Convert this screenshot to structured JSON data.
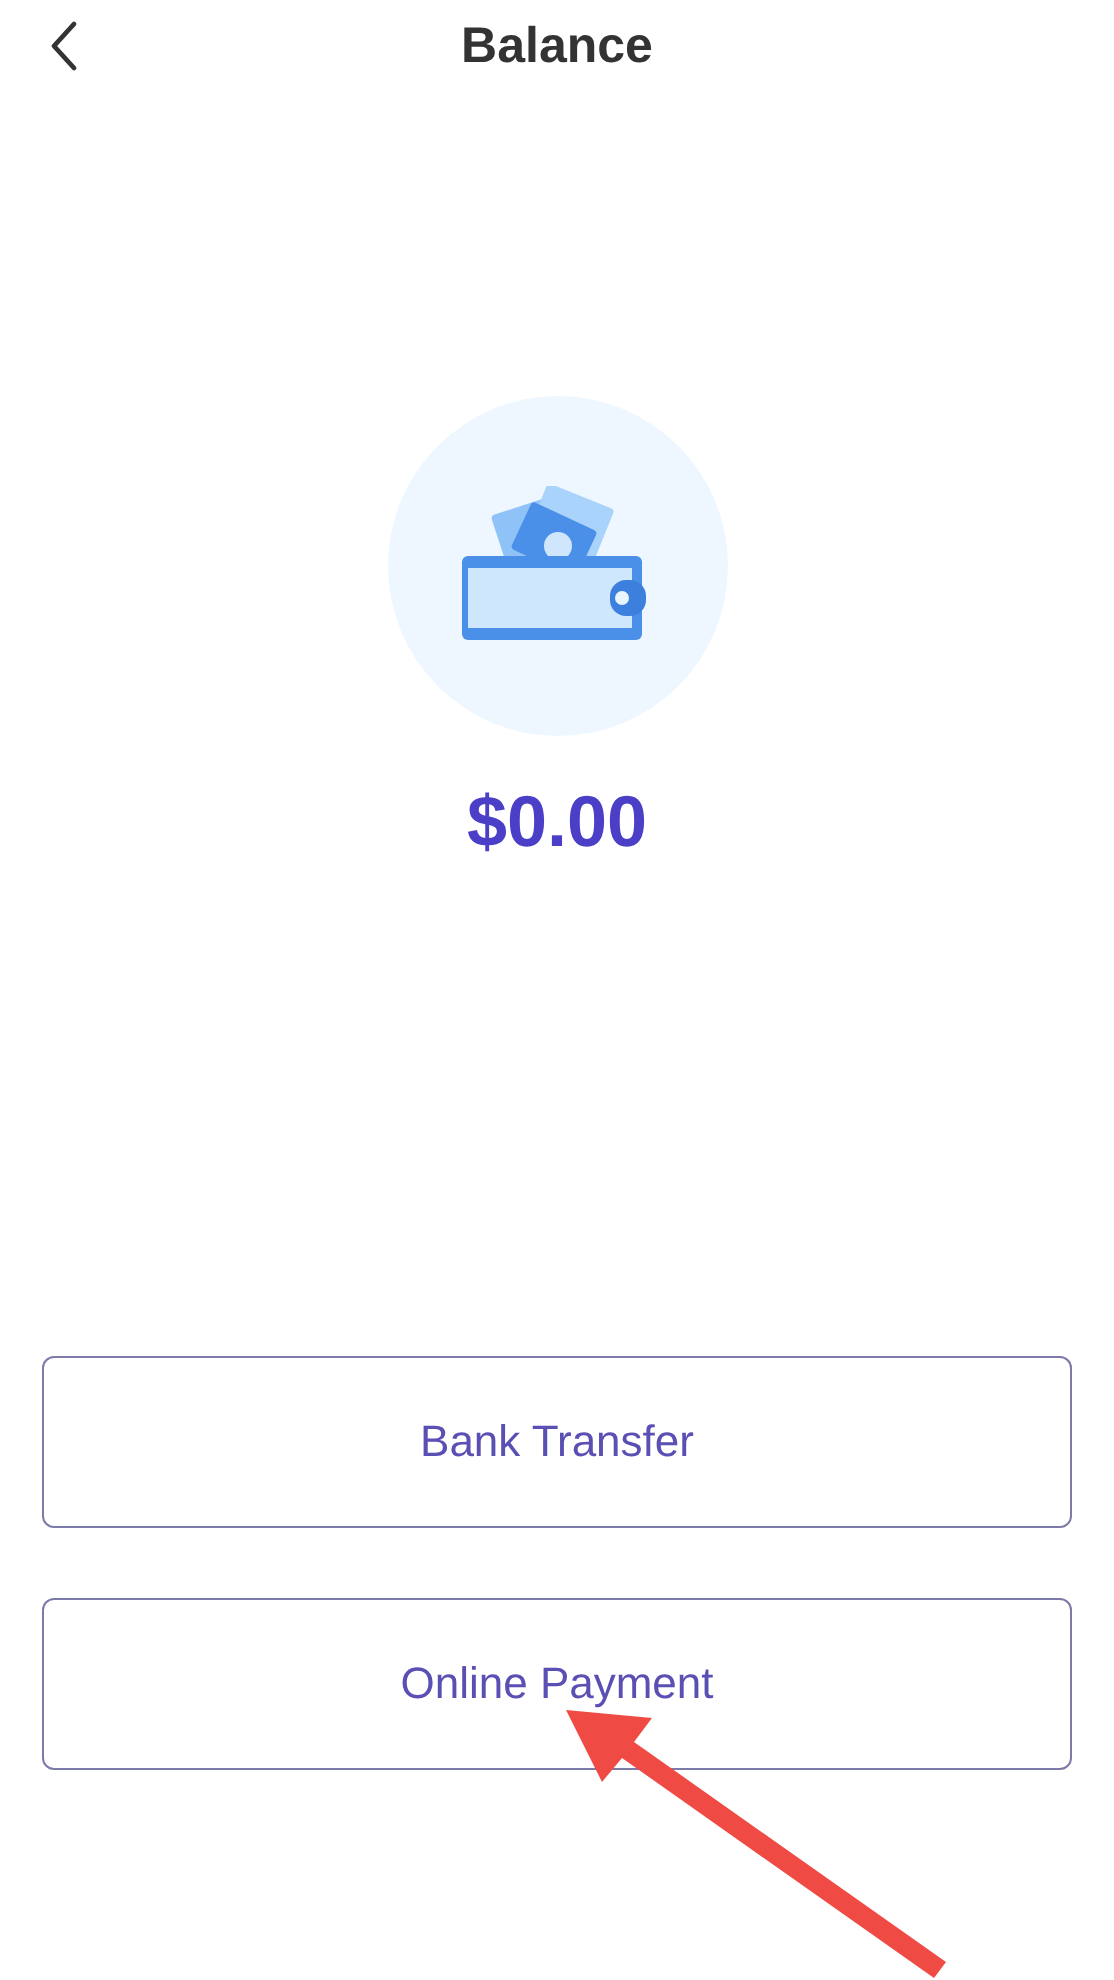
{
  "header": {
    "title": "Balance"
  },
  "balance": {
    "amount": "$0.00"
  },
  "buttons": [
    {
      "label": "Bank Transfer"
    },
    {
      "label": "Online Payment"
    }
  ]
}
